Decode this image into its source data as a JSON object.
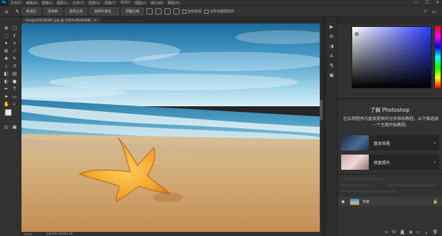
{
  "menubar": {
    "logo": "Ps",
    "items": [
      "文件(F)",
      "编辑(E)",
      "图像(I)",
      "图层(L)",
      "文字(Y)",
      "选择(S)",
      "滤镜(T)",
      "3D(D)",
      "视图(V)",
      "窗口(W)",
      "帮助(H)"
    ],
    "window_controls": [
      "—",
      "☐",
      "✕"
    ]
  },
  "options": {
    "btn1": "新选区",
    "btn2": "添加到",
    "btn3": "选择主体",
    "btn4": "选择并遮住...",
    "btn5": "调整边缘",
    "auto_enhance": "自动增强",
    "sample_all": "对所有图层取样"
  },
  "document": {
    "tab_title": "timg(104)26WC.jpg @ 200%(RGB/8#)",
    "close": "✕"
  },
  "status": {
    "zoom": "200%",
    "doc_info": "文档:983.8K/983.8K"
  },
  "learn": {
    "title": "了解 Photoshop",
    "subtitle": "在应用程序内直接提供的分步指导教程。从下面选择一个主题开始教程。",
    "cards": [
      {
        "label": "基本技能"
      },
      {
        "label": "修复照片"
      }
    ]
  },
  "layers": {
    "layer_name": "背景"
  },
  "colors": {
    "accent": "#31a8ff",
    "panel_bg": "#323232",
    "menu_bg": "#323232"
  }
}
